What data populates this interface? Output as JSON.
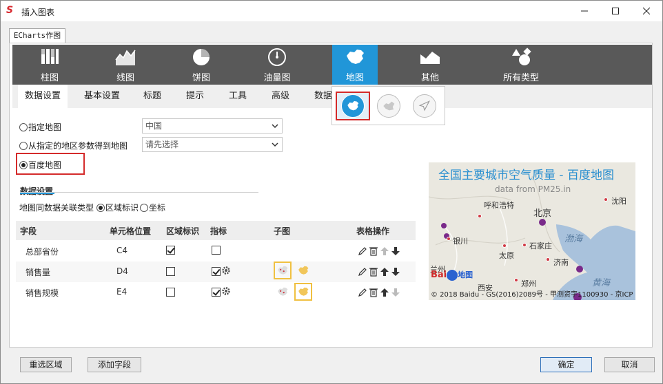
{
  "window": {
    "title": "插入图表"
  },
  "doc_tab": "ECharts作图",
  "chart_types": [
    {
      "label": "柱图",
      "icon": "bar-chart-icon"
    },
    {
      "label": "线图",
      "icon": "line-chart-icon"
    },
    {
      "label": "饼图",
      "icon": "pie-chart-icon"
    },
    {
      "label": "油量图",
      "icon": "gauge-icon"
    },
    {
      "label": "地图",
      "icon": "china-map-icon",
      "active": true
    },
    {
      "label": "其他",
      "icon": "area-shape-icon"
    },
    {
      "label": "所有类型",
      "icon": "shapes-icon"
    }
  ],
  "sub_tabs": [
    "数据设置",
    "基本设置",
    "标题",
    "提示",
    "工具",
    "高级",
    "数据"
  ],
  "map_options": [
    "china-map-option-icon",
    "province-map-option-icon",
    "flight-map-option-icon"
  ],
  "source": {
    "opt_specified": "指定地图",
    "opt_from_param": "从指定的地区参数得到地图",
    "opt_baidu": "百度地图",
    "select_region": "中国",
    "select_param_placeholder": "请先选择"
  },
  "data_section": {
    "title": "数据设置",
    "link_type_label": "地图同数据关联类型",
    "link_region": "区域标识",
    "link_coord": "坐标"
  },
  "grid": {
    "headers": [
      "字段",
      "单元格位置",
      "区域标识",
      "指标",
      "子图",
      "表格操作"
    ],
    "rows": [
      {
        "field": "总部省份",
        "cell": "C4",
        "region": true,
        "metric": false,
        "has_sub": false
      },
      {
        "field": "销售量",
        "cell": "D4",
        "region": false,
        "metric": true,
        "has_sub": true,
        "sub_selected": 0
      },
      {
        "field": "销售规模",
        "cell": "E4",
        "region": false,
        "metric": true,
        "has_sub": true,
        "sub_selected": 1
      }
    ]
  },
  "preview": {
    "title": "全国主要城市空气质量 - 百度地图",
    "subtitle": "data from PM25.in",
    "cities": {
      "beijing": "北京",
      "hohhot": "呼和浩特",
      "shenyang": "沈阳",
      "yinchuan": "银川",
      "shijiazhuang": "石家庄",
      "taiyuan": "太原",
      "jinan": "济南",
      "lanzhou": "兰州",
      "zhengzhou": "郑州",
      "xian": "西安"
    },
    "seas": {
      "bohai": "渤海",
      "yellow": "黄海"
    },
    "logo_bai": "Bai",
    "logo_map": "地图",
    "copyright": "© 2018 Baidu - GS(2016)2089号 - 甲测资字1100930 - 京ICP"
  },
  "buttons": {
    "reselect": "重选区域",
    "add_field": "添加字段",
    "ok": "确定",
    "cancel": "取消"
  },
  "colors": {
    "accent": "#2196d8",
    "toolbar": "#595959",
    "highlight": "#d42a2a"
  }
}
